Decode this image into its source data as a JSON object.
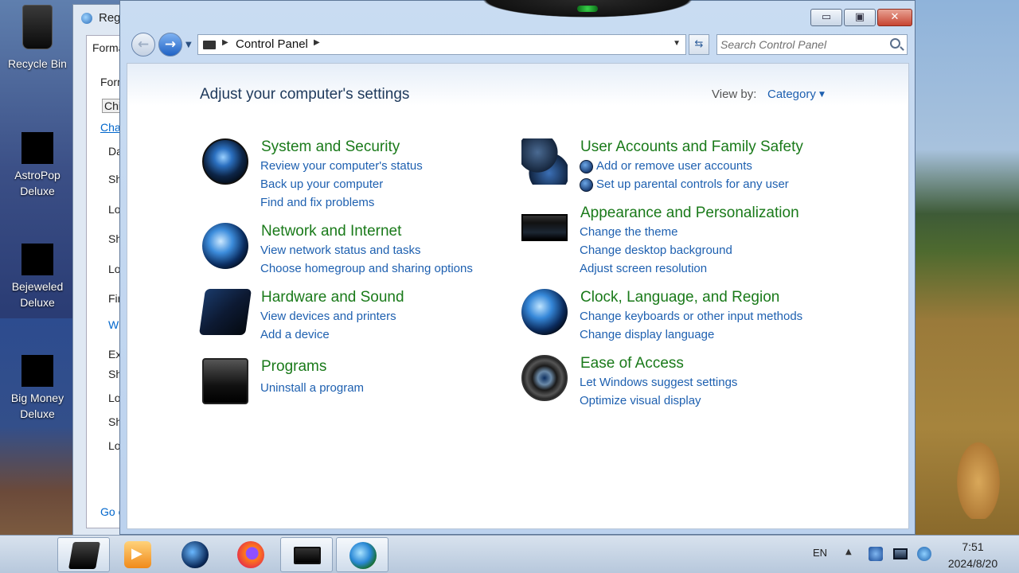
{
  "desktop": {
    "icons": [
      {
        "label": "Recycle Bin"
      },
      {
        "label": "AstroPop\nDeluxe"
      },
      {
        "label": "Bejeweled\nDeluxe"
      },
      {
        "label": "Big Money\nDeluxe"
      }
    ]
  },
  "background_window": {
    "title": "Reg",
    "tab": "Forma",
    "lines": [
      "Form",
      "Chi",
      "Cha",
      "Da",
      "Sh",
      "Lo",
      "Sh",
      "Lo",
      "Fir",
      "W",
      "Ex",
      "Sh",
      "Lo",
      "Sh",
      "Lo",
      "Go c"
    ]
  },
  "window": {
    "minimize_label": "▭",
    "maximize_label": "▣",
    "close_label": "✕",
    "address": {
      "crumb": "Control Panel"
    },
    "search": {
      "placeholder": "Search Control Panel"
    },
    "page_title": "Adjust your computer's settings",
    "view_by_label": "View by:",
    "view_by_value": "Category",
    "categories": [
      {
        "title": "System and Security",
        "icon": "shield-globe-icon",
        "links": [
          "Review your computer's status",
          "Back up your computer",
          "Find and fix problems"
        ]
      },
      {
        "title": "Network and Internet",
        "icon": "network-globe-icon",
        "links": [
          "View network status and tasks",
          "Choose homegroup and sharing options"
        ]
      },
      {
        "title": "Hardware and Sound",
        "icon": "printer-speaker-icon",
        "links": [
          "View devices and printers",
          "Add a device"
        ]
      },
      {
        "title": "Programs",
        "icon": "programs-disc-icon",
        "links": [
          "Uninstall a program"
        ]
      },
      {
        "title": "User Accounts and Family Safety",
        "icon": "users-icon",
        "links": [
          "Add or remove user accounts",
          "Set up parental controls for any user"
        ]
      },
      {
        "title": "Appearance and Personalization",
        "icon": "monitor-icon",
        "links": [
          "Change the theme",
          "Change desktop background",
          "Adjust screen resolution"
        ]
      },
      {
        "title": "Clock, Language, and Region",
        "icon": "clock-globe-icon",
        "links": [
          "Change keyboards or other input methods",
          "Change display language"
        ]
      },
      {
        "title": "Ease of Access",
        "icon": "ease-of-access-icon",
        "links": [
          "Let Windows suggest settings",
          "Optimize visual display"
        ]
      }
    ]
  },
  "taskbar": {
    "language": "EN",
    "time": "7:51",
    "date": "2024/8/20"
  }
}
